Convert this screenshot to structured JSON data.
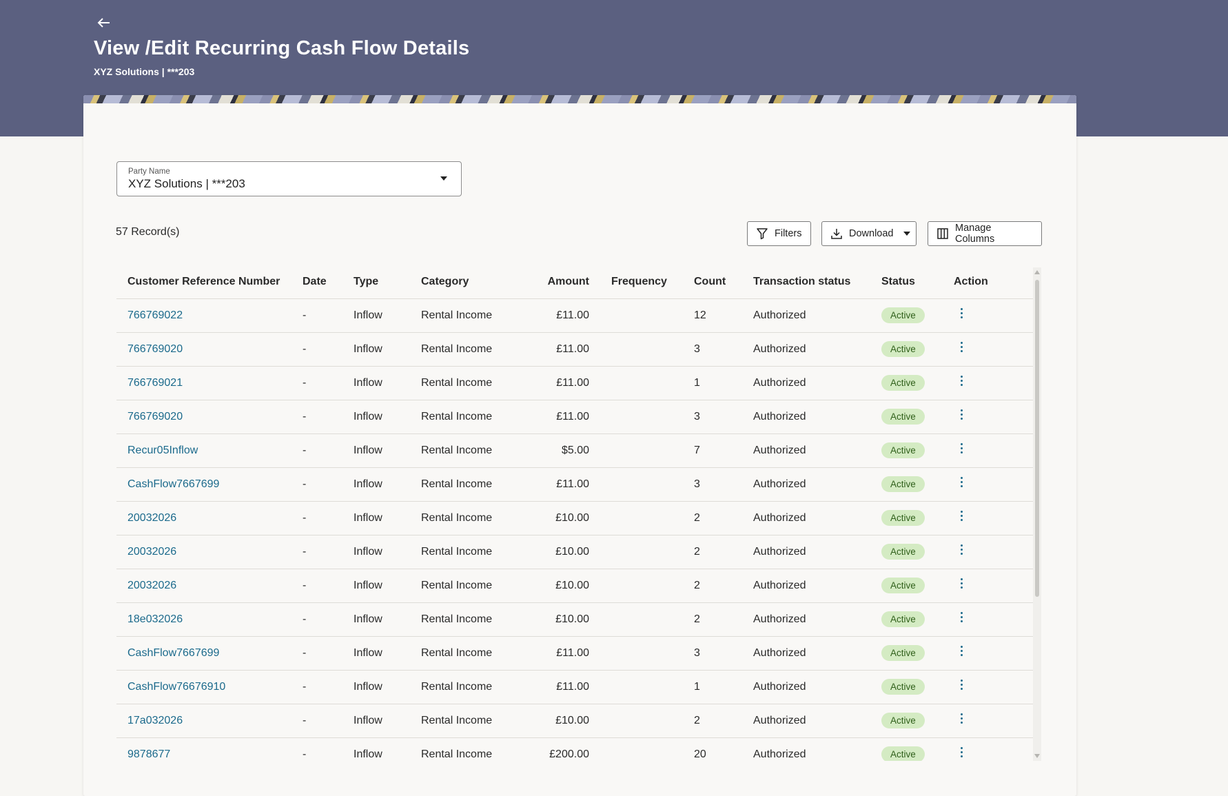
{
  "header": {
    "back_icon": "arrow-left-icon",
    "title": "View /Edit Recurring Cash Flow Details",
    "subtitle": "XYZ Solutions | ***203"
  },
  "party": {
    "label": "Party Name",
    "value": "XYZ Solutions | ***203"
  },
  "toolbar": {
    "records": "57 Record(s)",
    "filters": "Filters",
    "download": "Download",
    "manage_columns": "Manage Columns"
  },
  "table": {
    "columns": [
      "Customer Reference Number",
      "Date",
      "Type",
      "Category",
      "Amount",
      "Frequency",
      "Count",
      "Transaction status",
      "Status",
      "Action"
    ],
    "rows": [
      {
        "ref": "766769022",
        "date": "-",
        "type": "Inflow",
        "category": "Rental Income",
        "amount": "£11.00",
        "frequency": "",
        "count": "12",
        "txn_status": "Authorized",
        "status": "Active"
      },
      {
        "ref": "766769020",
        "date": "-",
        "type": "Inflow",
        "category": "Rental Income",
        "amount": "£11.00",
        "frequency": "",
        "count": "3",
        "txn_status": "Authorized",
        "status": "Active"
      },
      {
        "ref": "766769021",
        "date": "-",
        "type": "Inflow",
        "category": "Rental Income",
        "amount": "£11.00",
        "frequency": "",
        "count": "1",
        "txn_status": "Authorized",
        "status": "Active"
      },
      {
        "ref": "766769020",
        "date": "-",
        "type": "Inflow",
        "category": "Rental Income",
        "amount": "£11.00",
        "frequency": "",
        "count": "3",
        "txn_status": "Authorized",
        "status": "Active"
      },
      {
        "ref": "Recur05Inflow",
        "date": "-",
        "type": "Inflow",
        "category": "Rental Income",
        "amount": "$5.00",
        "frequency": "",
        "count": "7",
        "txn_status": "Authorized",
        "status": "Active"
      },
      {
        "ref": "CashFlow7667699",
        "date": "-",
        "type": "Inflow",
        "category": "Rental Income",
        "amount": "£11.00",
        "frequency": "",
        "count": "3",
        "txn_status": "Authorized",
        "status": "Active"
      },
      {
        "ref": "20032026",
        "date": "-",
        "type": "Inflow",
        "category": "Rental Income",
        "amount": "£10.00",
        "frequency": "",
        "count": "2",
        "txn_status": "Authorized",
        "status": "Active"
      },
      {
        "ref": "20032026",
        "date": "-",
        "type": "Inflow",
        "category": "Rental Income",
        "amount": "£10.00",
        "frequency": "",
        "count": "2",
        "txn_status": "Authorized",
        "status": "Active"
      },
      {
        "ref": "20032026",
        "date": "-",
        "type": "Inflow",
        "category": "Rental Income",
        "amount": "£10.00",
        "frequency": "",
        "count": "2",
        "txn_status": "Authorized",
        "status": "Active"
      },
      {
        "ref": "18e032026",
        "date": "-",
        "type": "Inflow",
        "category": "Rental Income",
        "amount": "£10.00",
        "frequency": "",
        "count": "2",
        "txn_status": "Authorized",
        "status": "Active"
      },
      {
        "ref": "CashFlow7667699",
        "date": "-",
        "type": "Inflow",
        "category": "Rental Income",
        "amount": "£11.00",
        "frequency": "",
        "count": "3",
        "txn_status": "Authorized",
        "status": "Active"
      },
      {
        "ref": "CashFlow76676910",
        "date": "-",
        "type": "Inflow",
        "category": "Rental Income",
        "amount": "£11.00",
        "frequency": "",
        "count": "1",
        "txn_status": "Authorized",
        "status": "Active"
      },
      {
        "ref": "17a032026",
        "date": "-",
        "type": "Inflow",
        "category": "Rental Income",
        "amount": "£10.00",
        "frequency": "",
        "count": "2",
        "txn_status": "Authorized",
        "status": "Active"
      },
      {
        "ref": "9878677",
        "date": "-",
        "type": "Inflow",
        "category": "Rental Income",
        "amount": "£200.00",
        "frequency": "",
        "count": "20",
        "txn_status": "Authorized",
        "status": "Active"
      }
    ]
  },
  "colors": {
    "header_bg": "#5b6080",
    "link": "#1b6a8c",
    "badge_bg": "#d4ebc3",
    "badge_text": "#2f5f1a"
  }
}
